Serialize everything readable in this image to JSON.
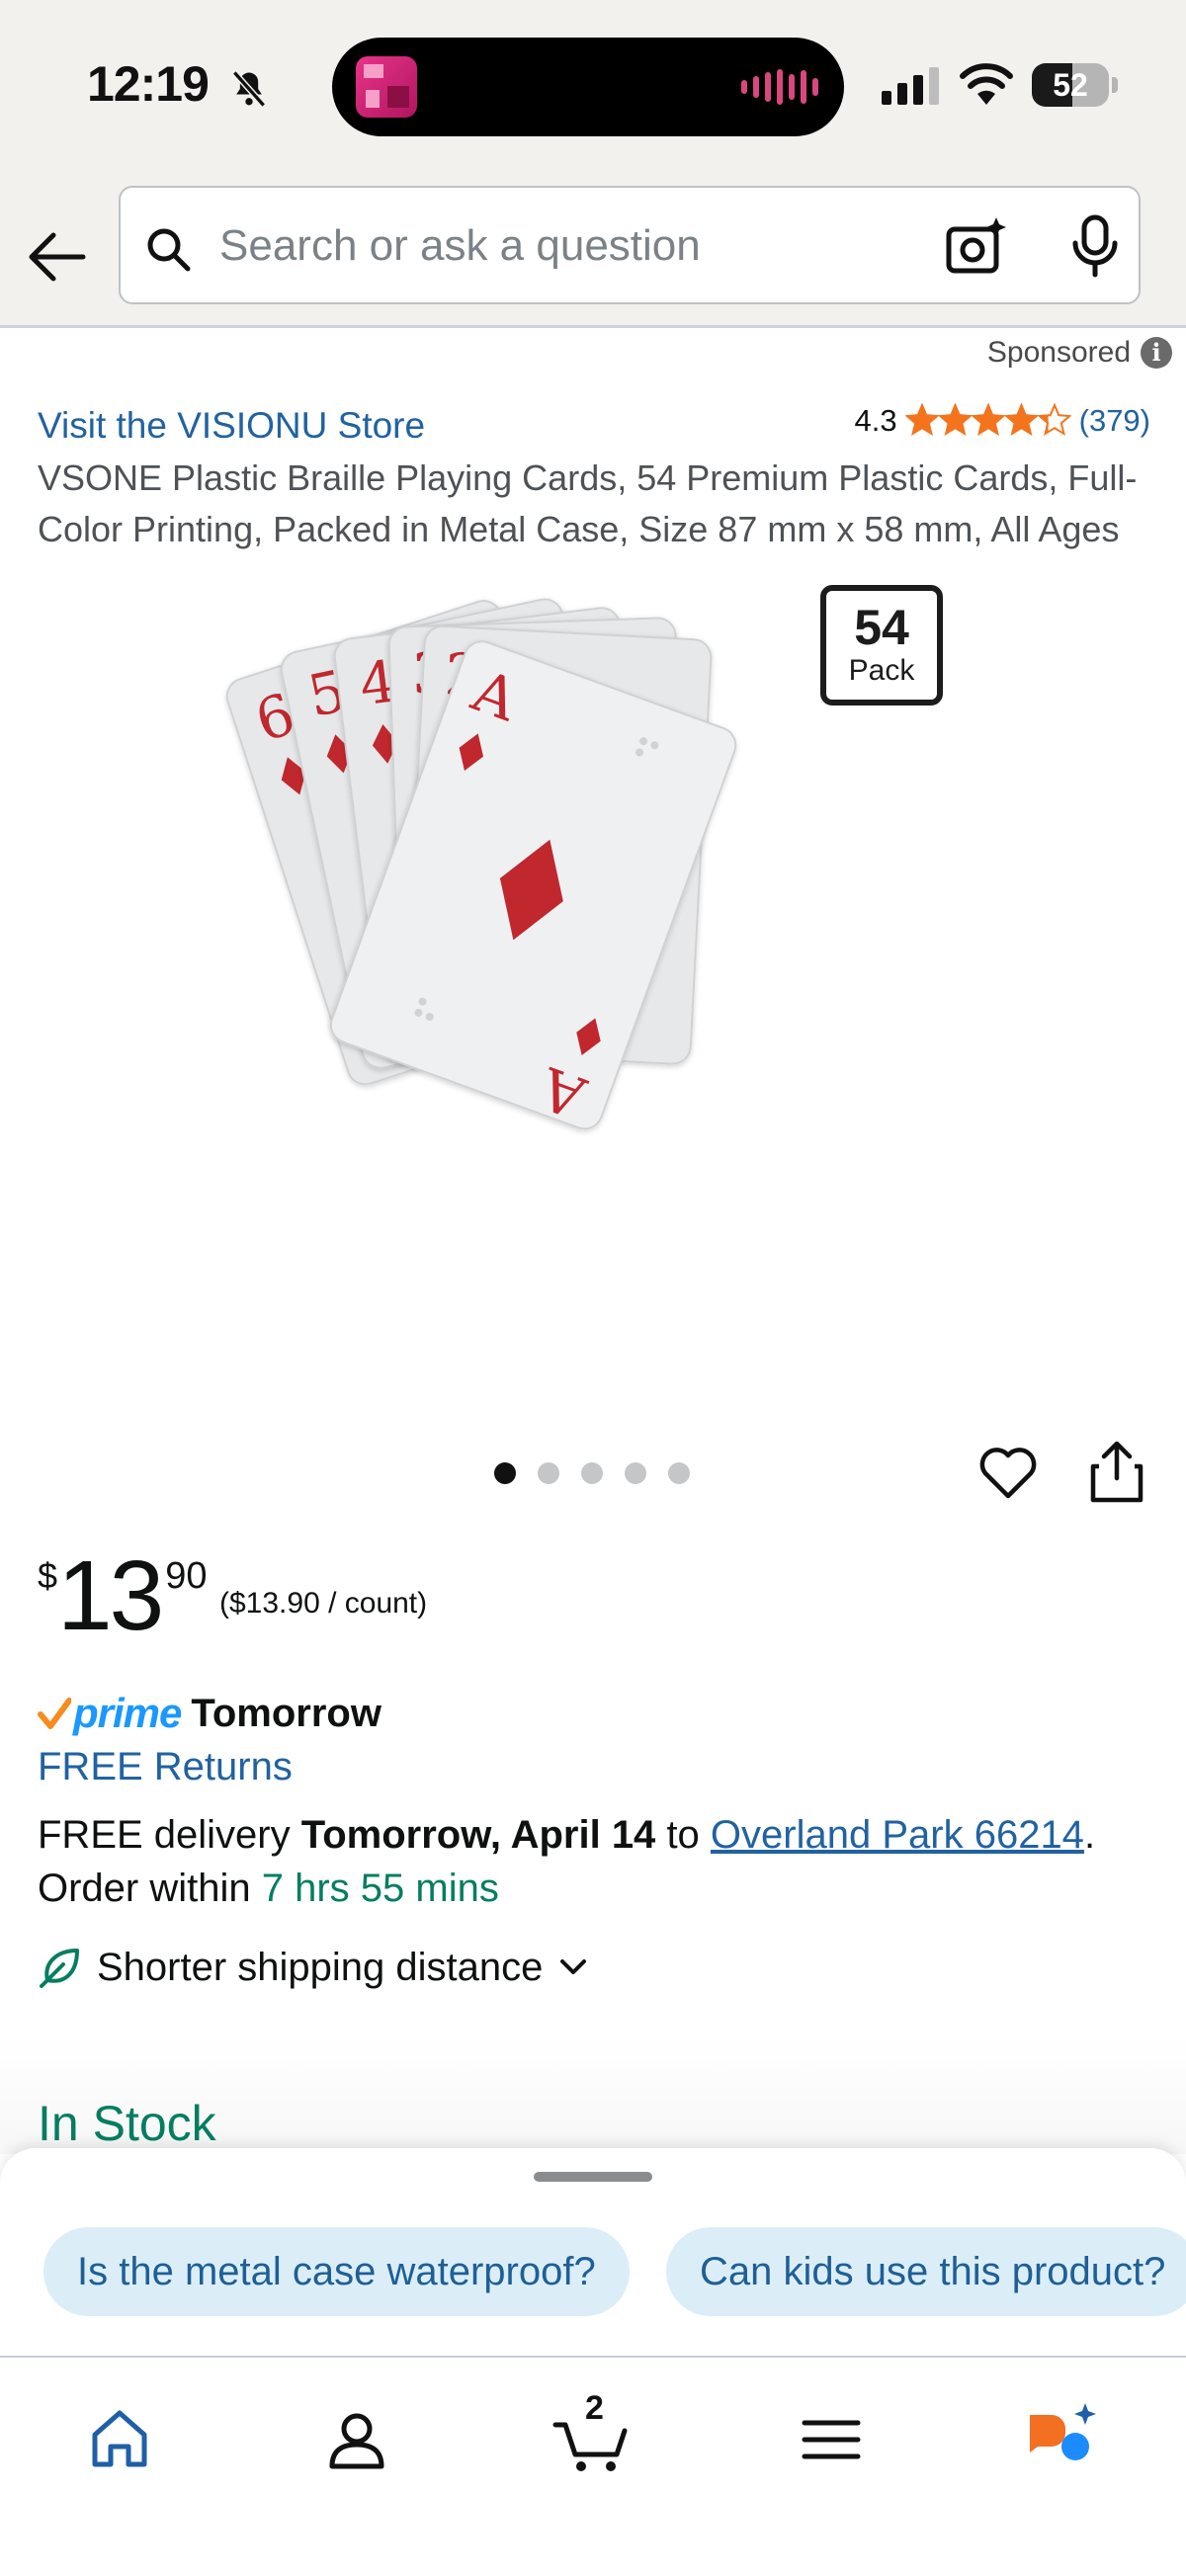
{
  "status_bar": {
    "time": "12:19",
    "battery_level": "52",
    "battery_fraction": 0.52,
    "signal_bars_active": 3,
    "signal_bars_total": 4
  },
  "search": {
    "placeholder": "Search or ask a question",
    "value": ""
  },
  "product": {
    "sponsored_label": "Sponsored",
    "store_link": "Visit the VISIONU Store",
    "rating_value": "4.3",
    "rating_stars": 4.3,
    "rating_count": "(379)",
    "title": "VSONE Plastic Braille Playing Cards, 54 Premium Plastic Cards, Full-Color Printing, Packed in Metal Case, Size 87 mm x 58 mm, All Ages",
    "pack_badge": {
      "number": "54",
      "label": "Pack"
    },
    "image_carousel": {
      "total": 5,
      "active_index": 0
    },
    "cards": [
      "6",
      "5",
      "4",
      "3",
      "2",
      "A"
    ],
    "suit_color": "#c0282d"
  },
  "price": {
    "symbol": "$",
    "whole": "13",
    "fraction": "90",
    "unit_price": "($13.90 / count)"
  },
  "delivery": {
    "prime_label": "prime",
    "prime_day": "Tomorrow",
    "free_returns": "FREE Returns",
    "free_delivery": "FREE delivery",
    "date": "Tomorrow, April 14",
    "to_label": "to",
    "location": "Overland Park 66214",
    "order_within": "Order within",
    "countdown": "7 hrs 55 mins",
    "shipping_note": "Shorter shipping distance"
  },
  "stock": {
    "label": "In Stock"
  },
  "suggestions": [
    "Is the metal case waterproof?",
    "Can kids use this product?"
  ],
  "tab_bar": {
    "items": [
      "home-icon",
      "account-icon",
      "cart-icon",
      "menu-icon",
      "rufus-icon"
    ],
    "cart_count": "2"
  },
  "colors": {
    "link": "#2162a1",
    "in_stock": "#067d62",
    "prime": "#1a98ff",
    "star": "#f3741c",
    "chip_bg": "#dbeef8"
  }
}
